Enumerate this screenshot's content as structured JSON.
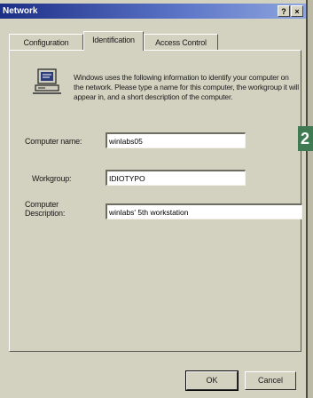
{
  "window": {
    "title": "Network"
  },
  "titlebar": {
    "help_label": "?",
    "close_label": "×"
  },
  "tabs": [
    {
      "label": "Configuration"
    },
    {
      "label": "Identification"
    },
    {
      "label": "Access Control"
    }
  ],
  "panel": {
    "description": "Windows uses the following information to identify your computer on the network.  Please type a name for this computer, the workgroup it will appear in, and a short description of the computer.",
    "computer_name": {
      "label": "Computer name:",
      "value": "winlabs05"
    },
    "workgroup": {
      "label": "Workgroup:",
      "value": "IDIOTYPO"
    },
    "computer_description": {
      "label_line1": "Computer",
      "label_line2": "Description:",
      "value": "winlabs' 5th workstation"
    }
  },
  "badge": {
    "text": "2"
  },
  "buttons": {
    "ok_label": "OK",
    "cancel_label": "Cancel"
  }
}
